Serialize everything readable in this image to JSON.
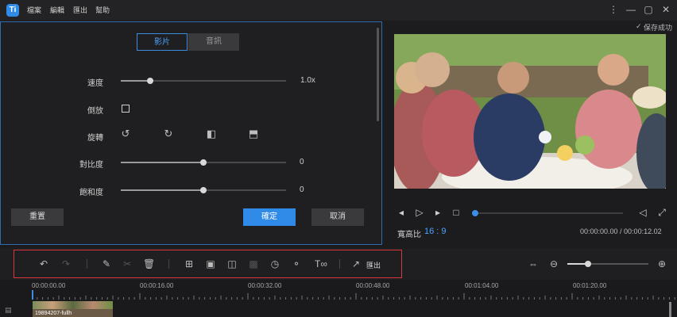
{
  "menu": [
    "檔案",
    "編輯",
    "匯出",
    "幫助"
  ],
  "window": {
    "logo": "Ti",
    "more": "⋮",
    "minimize": "—",
    "maximize": "▢",
    "close": "✕"
  },
  "tabs": {
    "video": "影片",
    "audio": "音訊"
  },
  "settings": {
    "speed": {
      "label": "速度",
      "value": "1.0x",
      "level": 0.18
    },
    "reverse": {
      "label": "倒放"
    },
    "rotate": {
      "label": "旋轉"
    },
    "contrast": {
      "label": "對比度",
      "value": "0",
      "level": 0.5
    },
    "saturation": {
      "label": "飽和度",
      "value": "0",
      "level": 0.5
    }
  },
  "buttons": {
    "reset": "重置",
    "ok": "確定",
    "cancel": "取消"
  },
  "preview": {
    "saved": "保存成功",
    "aspect_label": "寬高比",
    "aspect_value": "16 : 9",
    "time": "00:00:00.00 / 00:00:12.02"
  },
  "toolbar": {
    "export_label": "匯出"
  },
  "timeline": {
    "ticks": [
      "00:00:00.00",
      "00:00:16.00",
      "00:00:32.00",
      "00:00:48.00",
      "00:01:04.00",
      "00:01:20.00"
    ],
    "clip_name": "19894207-fullh"
  },
  "colors": {
    "accent": "#2f8ae8",
    "highlight_border": "#d9363e",
    "panel_border": "#2a6db0"
  },
  "icons": [
    "undo-icon",
    "redo-icon",
    "pencil-icon",
    "scissors-icon",
    "trash-icon",
    "crop-icon",
    "mosaic-icon",
    "split-icon",
    "pip-icon",
    "clock-icon",
    "microphone-icon",
    "text-icon",
    "share-icon",
    "fit-icon",
    "zoom-out-icon",
    "zoom-in-icon"
  ],
  "zoom_level": 0.25
}
